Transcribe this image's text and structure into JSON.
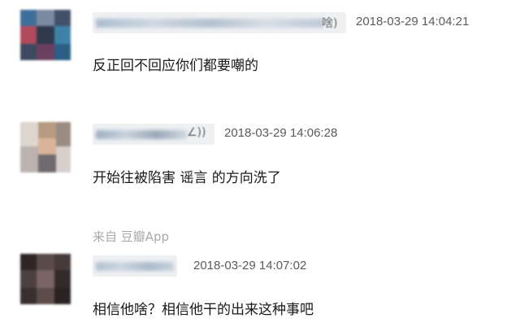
{
  "comments": [
    {
      "username_suffix": "啥)",
      "timestamp": "2018-03-29 14:04:21",
      "text": "反正回不回应你们都要嘲的"
    },
    {
      "username_suffix": "∠))",
      "timestamp": "2018-03-29 14:06:28",
      "text": "开始往被陷害 谣言 的方向洗了"
    },
    {
      "username_suffix": "",
      "timestamp": "2018-03-29 14:07:02",
      "text": "相信他啥？相信他干的出来这种事吧"
    }
  ],
  "source_label": "来自 豆瓣App"
}
